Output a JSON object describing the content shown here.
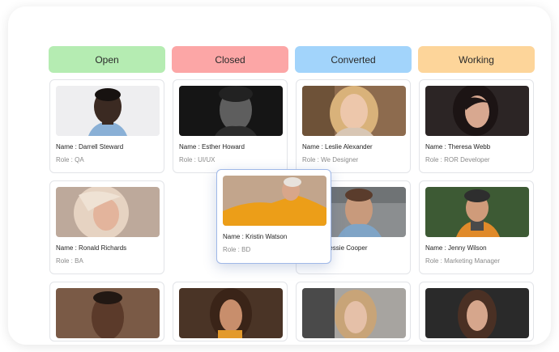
{
  "columns": [
    {
      "label": "Open",
      "color": "#b5ecb2"
    },
    {
      "label": "Closed",
      "color": "#fca6a6"
    },
    {
      "label": "Converted",
      "color": "#a2d4fb"
    },
    {
      "label": "Working",
      "color": "#fdd59a"
    }
  ],
  "cards": {
    "darrell": {
      "name": "Name : Darrell Steward",
      "role": "Role : QA"
    },
    "esther": {
      "name": "Name : Esther Howard",
      "role": "Role : UI/UX"
    },
    "leslie": {
      "name": "Name : Leslie Alexander",
      "role": "Role : We Designer"
    },
    "theresa": {
      "name": "Name : Theresa Webb",
      "role": "Role : ROR Developer"
    },
    "ronald": {
      "name": "Name : Ronald Richards",
      "role": "Role : BA"
    },
    "kristin": {
      "name": "Name : Kristin Watson",
      "role": "Role : BD"
    },
    "bessie": {
      "name": "Name : Bessie Cooper",
      "role": ""
    },
    "jenny": {
      "name": "Name : Jenny Wilson",
      "role": "Role : Marketing Manager"
    }
  }
}
